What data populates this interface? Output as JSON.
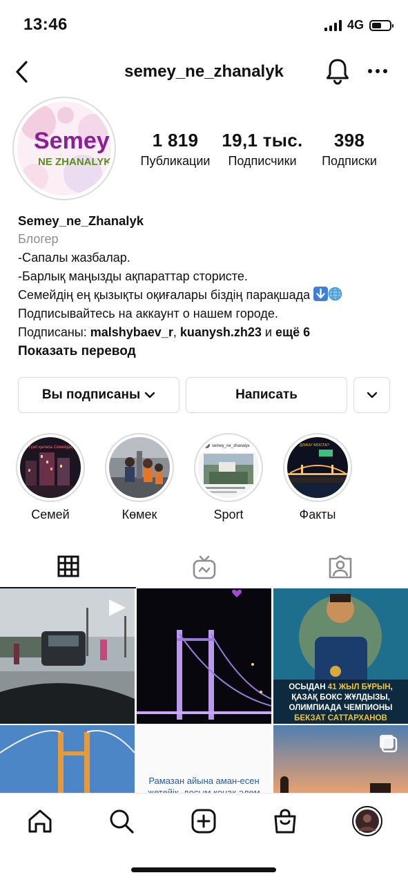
{
  "status_bar": {
    "time": "13:46",
    "network": "4G",
    "battery_level": 0.55
  },
  "header": {
    "username": "semey_ne_zhanalyk"
  },
  "profile": {
    "logo_text_line1": "Semey",
    "logo_text_line2": "NE ZHANALYK",
    "stats": [
      {
        "value": "1 819",
        "label": "Публикации"
      },
      {
        "value": "19,1 тыс.",
        "label": "Подписчики"
      },
      {
        "value": "398",
        "label": "Подписки"
      }
    ]
  },
  "bio": {
    "name": "Semey_ne_Zhanalyk",
    "category": "Блогер",
    "line1": "-Сапалы жазбалар.",
    "line2": "-Барлық маңызды ақпараттар стористе.",
    "line3": "Семейдің ең қызықты оқиғалары біздің парақшада",
    "line4": "Подписывайтесь на аккаунт о нашем городе.",
    "followed_by_prefix": "Подписаны: ",
    "followed_by_user1": "malshybaev_r",
    "followed_by_sep": ", ",
    "followed_by_user2": "kuanysh.zh23",
    "followed_by_and": " и ",
    "followed_by_more": "ещё 6",
    "translate": "Показать перевод"
  },
  "actions": {
    "following": "Вы подписаны",
    "message": "Написать"
  },
  "highlights": [
    {
      "label": "Семей",
      "caption": "Түнгі қаласы Семейдің"
    },
    {
      "label": "Көмек"
    },
    {
      "label": "Sport",
      "caption_user": "semey_ne_zhanalyk"
    },
    {
      "label": "Факты",
      "caption": "ДЛИНУ МОСТА?"
    }
  ],
  "grid": {
    "post3_caption_pre": "ОСЫДАН ",
    "post3_caption_hl": "41 ЖЫЛ БҰРЫН",
    "post3_caption_mid": ", ҚАЗАҚ БОКС ЖҰЛДЫЗЫ, ОЛИМПИАДА ЧЕМПИОНЫ ",
    "post3_caption_end": "БЕКЗАТ САТТАРХАНОВ ДҮНИЕГЕ КЕЛДІ",
    "post5_text": "Рамазан айына аман-есен жетейік, досым қонақ әлем"
  }
}
